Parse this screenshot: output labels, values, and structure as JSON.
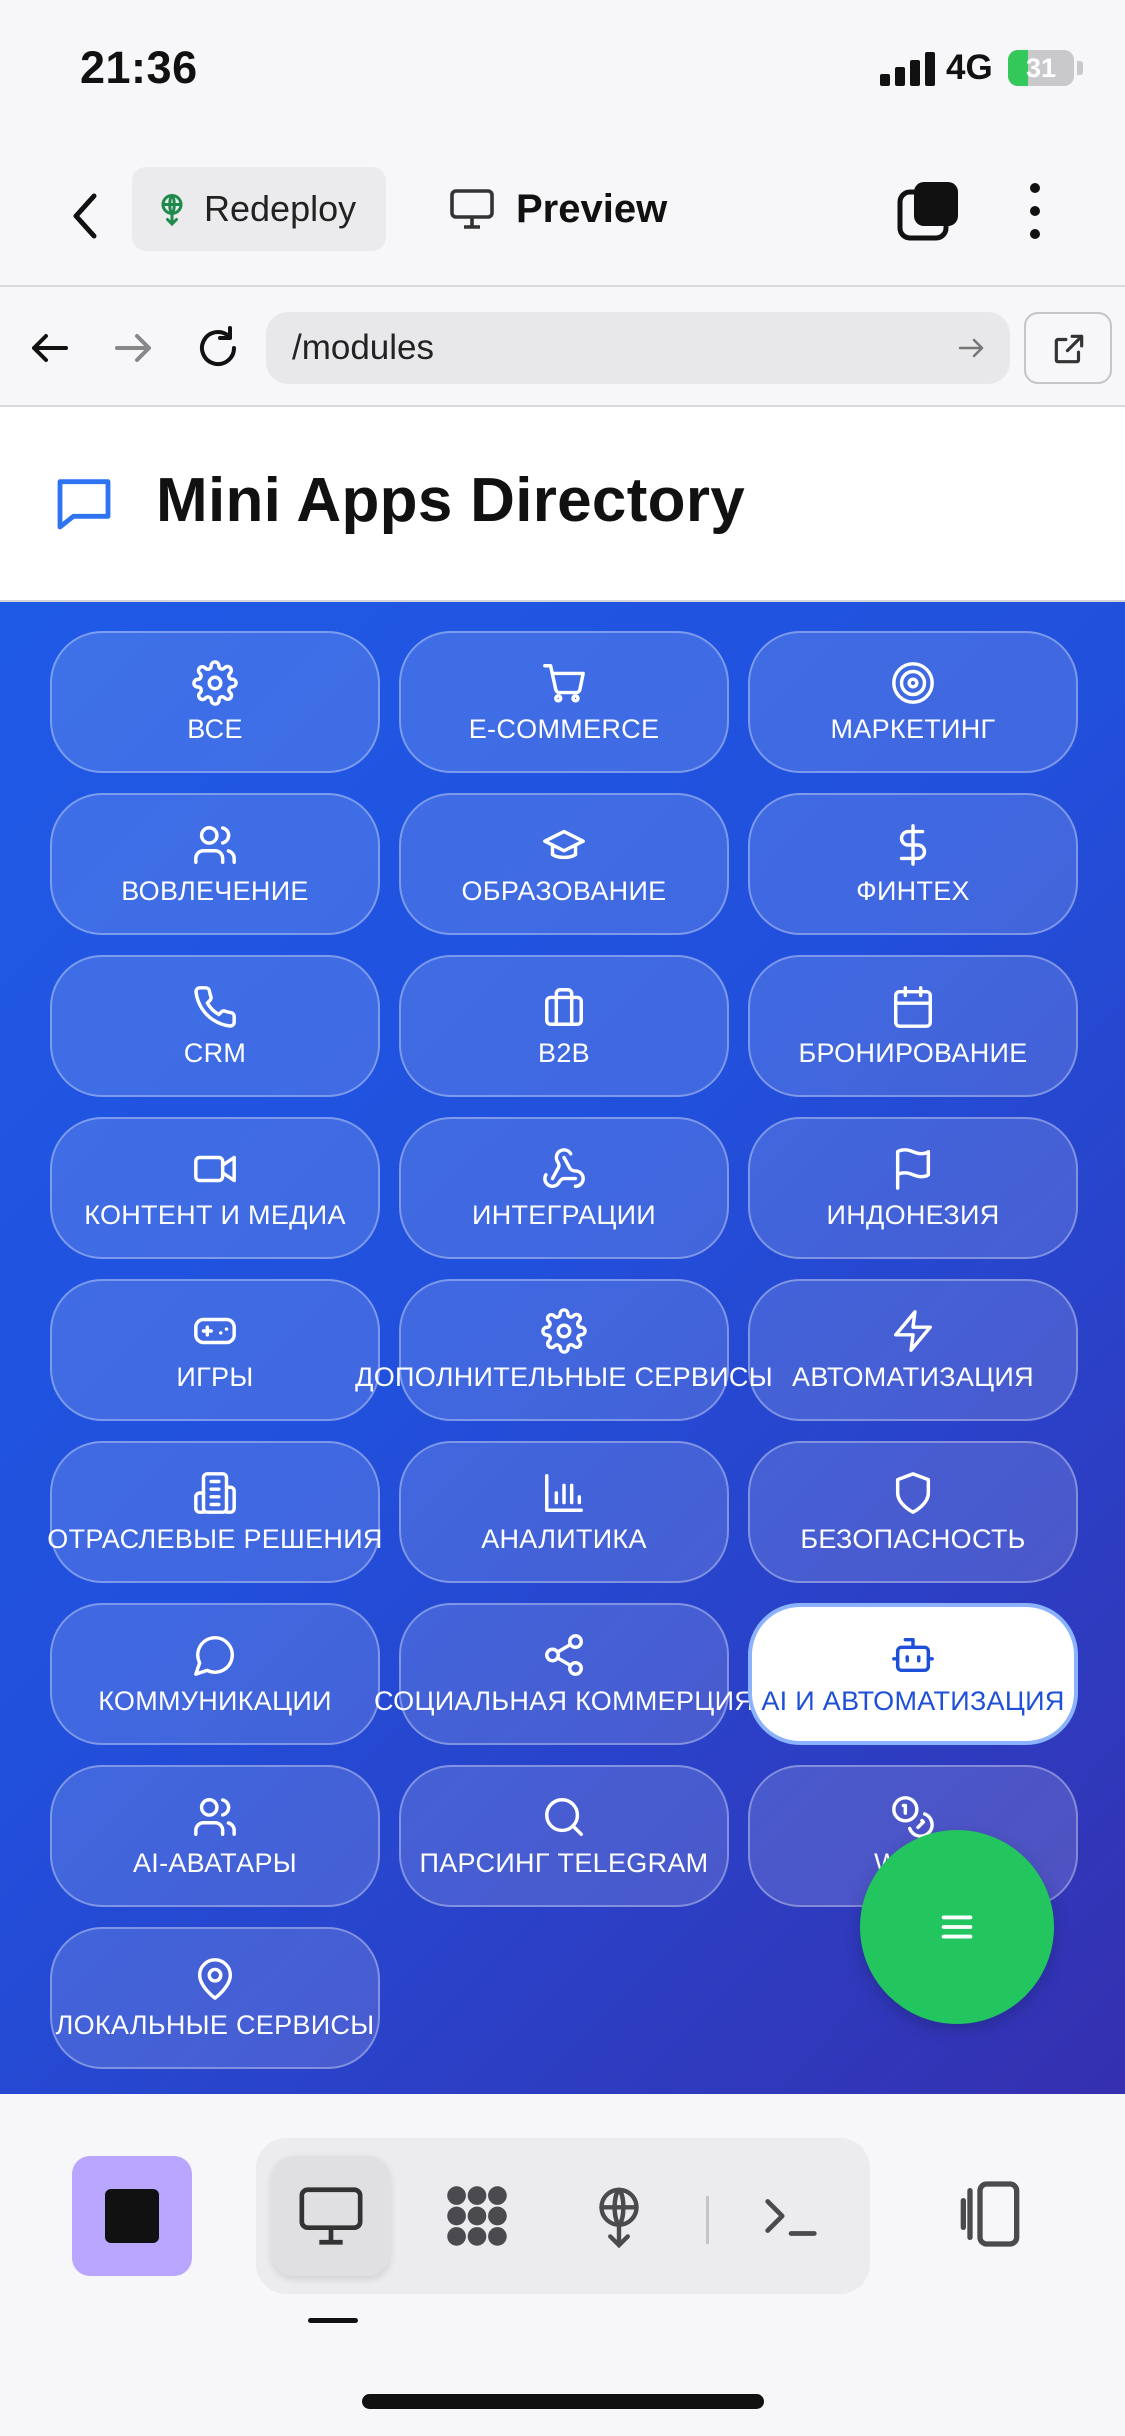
{
  "status": {
    "time": "21:36",
    "network": "4G",
    "battery_level": "31",
    "battery_fraction": 0.31
  },
  "toolbar": {
    "redeploy_label": "Redeploy",
    "preview_label": "Preview"
  },
  "urlbar": {
    "path": "/modules"
  },
  "page": {
    "title": "Mini Apps Directory"
  },
  "categories": [
    {
      "label": "ВСЕ",
      "icon": "gear-icon"
    },
    {
      "label": "E-COMMERCE",
      "icon": "cart-icon"
    },
    {
      "label": "МАРКЕТИНГ",
      "icon": "target-icon"
    },
    {
      "label": "ВОВЛЕЧЕНИЕ",
      "icon": "users-icon"
    },
    {
      "label": "ОБРАЗОВАНИЕ",
      "icon": "graduation-cap-icon"
    },
    {
      "label": "ФИНТЕХ",
      "icon": "dollar-icon"
    },
    {
      "label": "CRM",
      "icon": "phone-icon"
    },
    {
      "label": "B2B",
      "icon": "briefcase-icon"
    },
    {
      "label": "БРОНИРОВАНИЕ",
      "icon": "calendar-icon"
    },
    {
      "label": "КОНТЕНТ И МЕДИА",
      "icon": "video-icon"
    },
    {
      "label": "ИНТЕГРАЦИИ",
      "icon": "webhook-icon"
    },
    {
      "label": "ИНДОНЕЗИЯ",
      "icon": "flag-icon"
    },
    {
      "label": "ИГРЫ",
      "icon": "gamepad-icon"
    },
    {
      "label": "ДОПОЛНИТЕЛЬНЫЕ СЕРВИСЫ",
      "icon": "gear-icon"
    },
    {
      "label": "АВТОМАТИЗАЦИЯ",
      "icon": "lightning-icon"
    },
    {
      "label": "ОТРАСЛЕВЫЕ РЕШЕНИЯ",
      "icon": "building-icon"
    },
    {
      "label": "АНАЛИТИКА",
      "icon": "bar-chart-icon"
    },
    {
      "label": "БЕЗОПАСНОСТЬ",
      "icon": "shield-icon"
    },
    {
      "label": "КОММУНИКАЦИИ",
      "icon": "message-circle-icon"
    },
    {
      "label": "СОЦИАЛЬНАЯ КОММЕРЦИЯ",
      "icon": "share-icon"
    },
    {
      "label": "AI И АВТОМАТИЗАЦИЯ",
      "icon": "bot-icon",
      "active": true
    },
    {
      "label": "AI-АВАТАРЫ",
      "icon": "users-icon"
    },
    {
      "label": "ПАРСИНГ TELEGRAM",
      "icon": "search-icon"
    },
    {
      "label": "WEB3",
      "icon": "coins-icon"
    },
    {
      "label": "ЛОКАЛЬНЫЕ СЕРВИСЫ",
      "icon": "map-pin-icon"
    }
  ],
  "colors": {
    "accent": "#1d4fd8",
    "fab": "#22c55e",
    "stop": "#b9a7ff",
    "battery_fill": "#34c759"
  }
}
